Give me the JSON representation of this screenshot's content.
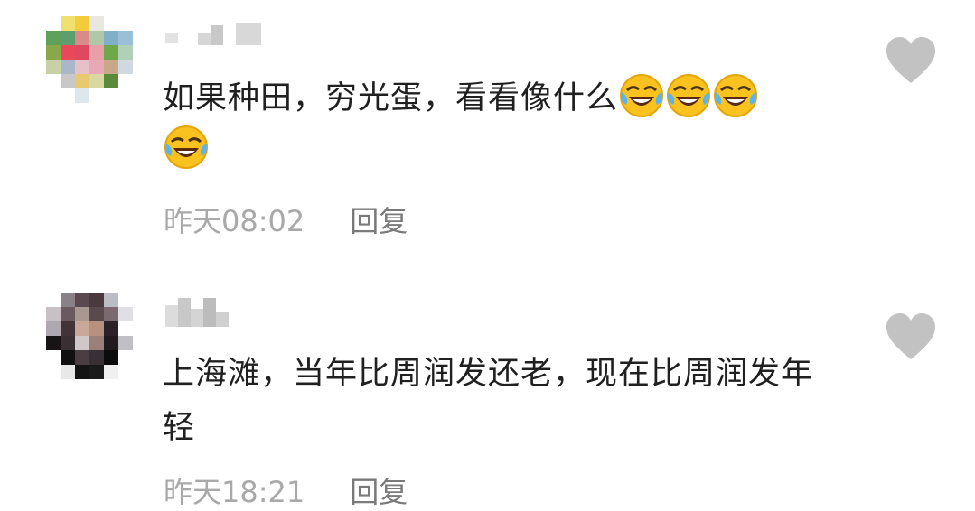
{
  "comments": [
    {
      "text_prefix": "如果种田，穷光蛋，看看像什么",
      "emoji": [
        "face-with-tears-of-joy-emoji",
        "face-with-tears-of-joy-emoji",
        "face-with-tears-of-joy-emoji",
        "face-with-tears-of-joy-emoji"
      ],
      "time": "昨天08:02",
      "reply_label": "回复"
    },
    {
      "text": "上海滩，当年比周润发还老，现在比周润发年轻",
      "time": "昨天18:21",
      "reply_label": "回复"
    }
  ],
  "icons": {
    "like": "heart-icon"
  },
  "colors": {
    "meta_text": "#a9a9a9",
    "reply_text": "#7a7a7a",
    "heart": "#c2c2c2"
  }
}
